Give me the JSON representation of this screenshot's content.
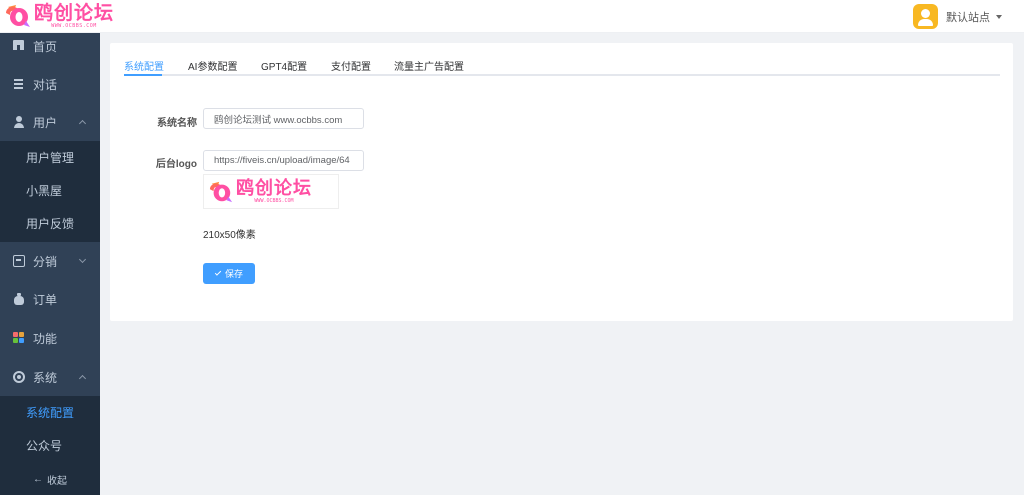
{
  "header": {
    "logo_title": "鸥创论坛",
    "logo_subtitle": "WWW.OCBBS.COM",
    "site_name": "默认站点"
  },
  "sidebar": {
    "items": [
      {
        "label": "首页",
        "icon": "home-icon"
      },
      {
        "label": "对话",
        "icon": "chat-list-icon"
      },
      {
        "label": "用户",
        "icon": "user-icon",
        "expanded": true,
        "children": [
          "用户管理",
          "小黑屋",
          "用户反馈"
        ]
      },
      {
        "label": "分销",
        "icon": "distribution-icon",
        "expanded": false
      },
      {
        "label": "订单",
        "icon": "money-bag-icon"
      },
      {
        "label": "功能",
        "icon": "apps-grid-icon"
      },
      {
        "label": "系统",
        "icon": "settings-icon",
        "expanded": true,
        "children": [
          "系统配置",
          "公众号"
        ]
      }
    ],
    "active_child": "系统配置",
    "collapse_label": "收起",
    "collapse_arrow": "←"
  },
  "tabs": [
    {
      "label": "系统配置",
      "active": true
    },
    {
      "label": "AI参数配置"
    },
    {
      "label": "GPT4配置"
    },
    {
      "label": "支付配置"
    },
    {
      "label": "流量主广告配置"
    }
  ],
  "form": {
    "system_name_label": "系统名称",
    "system_name_value": "鸥创论坛测试 www.ocbbs.com",
    "logo_label": "后台logo",
    "logo_url_value": "https://fiveis.cn/upload/image/64",
    "logo_preview_title": "鸥创论坛",
    "logo_preview_subtitle": "WWW.OCBBS.COM",
    "logo_size_hint": "210x50像素",
    "save_label": "保存"
  },
  "colors": {
    "sidebar_bg": "#304156",
    "submenu_bg": "#1f2d3d",
    "accent": "#409eff",
    "brand_pink": "#ff4fa3",
    "avatar_bg": "#f8b822"
  }
}
